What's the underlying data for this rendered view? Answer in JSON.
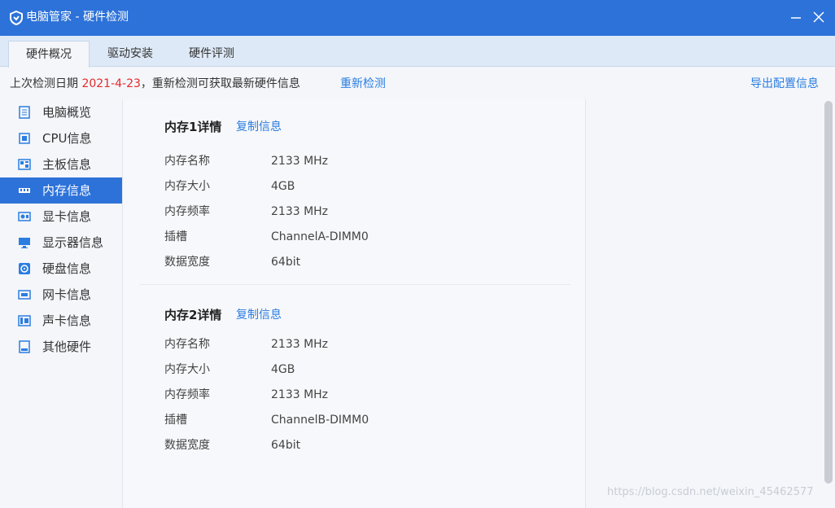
{
  "window": {
    "title": "电脑管家 - 硬件检测",
    "minimize_icon": "minimize-icon",
    "close_icon": "close-icon"
  },
  "tabs": [
    {
      "label": "硬件概况",
      "active": true
    },
    {
      "label": "驱动安装",
      "active": false
    },
    {
      "label": "硬件评测",
      "active": false
    }
  ],
  "infobar": {
    "prefix": "上次检测日期 ",
    "date": "2021-4-23",
    "suffix": "，重新检测可获取最新硬件信息",
    "recheck_label": "重新检测",
    "export_label": "导出配置信息"
  },
  "sidebar": {
    "items": [
      {
        "label": "电脑概览",
        "icon": "overview-icon",
        "active": false
      },
      {
        "label": "CPU信息",
        "icon": "cpu-icon",
        "active": false
      },
      {
        "label": "主板信息",
        "icon": "motherboard-icon",
        "active": false
      },
      {
        "label": "内存信息",
        "icon": "memory-icon",
        "active": true
      },
      {
        "label": "显卡信息",
        "icon": "graphics-card-icon",
        "active": false
      },
      {
        "label": "显示器信息",
        "icon": "monitor-icon",
        "active": false
      },
      {
        "label": "硬盘信息",
        "icon": "disk-icon",
        "active": false
      },
      {
        "label": "网卡信息",
        "icon": "network-card-icon",
        "active": false
      },
      {
        "label": "声卡信息",
        "icon": "sound-card-icon",
        "active": false
      },
      {
        "label": "其他硬件",
        "icon": "other-hardware-icon",
        "active": false
      }
    ]
  },
  "memory": [
    {
      "title": "内存1详情",
      "copy_label": "复制信息",
      "rows": [
        {
          "label": "内存名称",
          "value": "2133 MHz"
        },
        {
          "label": "内存大小",
          "value": "4GB"
        },
        {
          "label": "内存频率",
          "value": "2133 MHz"
        },
        {
          "label": "插槽",
          "value": "ChannelA-DIMM0"
        },
        {
          "label": "数据宽度",
          "value": "64bit"
        }
      ]
    },
    {
      "title": "内存2详情",
      "copy_label": "复制信息",
      "rows": [
        {
          "label": "内存名称",
          "value": "2133 MHz"
        },
        {
          "label": "内存大小",
          "value": "4GB"
        },
        {
          "label": "内存频率",
          "value": "2133 MHz"
        },
        {
          "label": "插槽",
          "value": "ChannelB-DIMM0"
        },
        {
          "label": "数据宽度",
          "value": "64bit"
        }
      ]
    }
  ],
  "watermark": "https://blog.csdn.net/weixin_45462577",
  "colors": {
    "accent": "#2d72d9",
    "link": "#2b7de0",
    "date": "#e32b2b"
  }
}
